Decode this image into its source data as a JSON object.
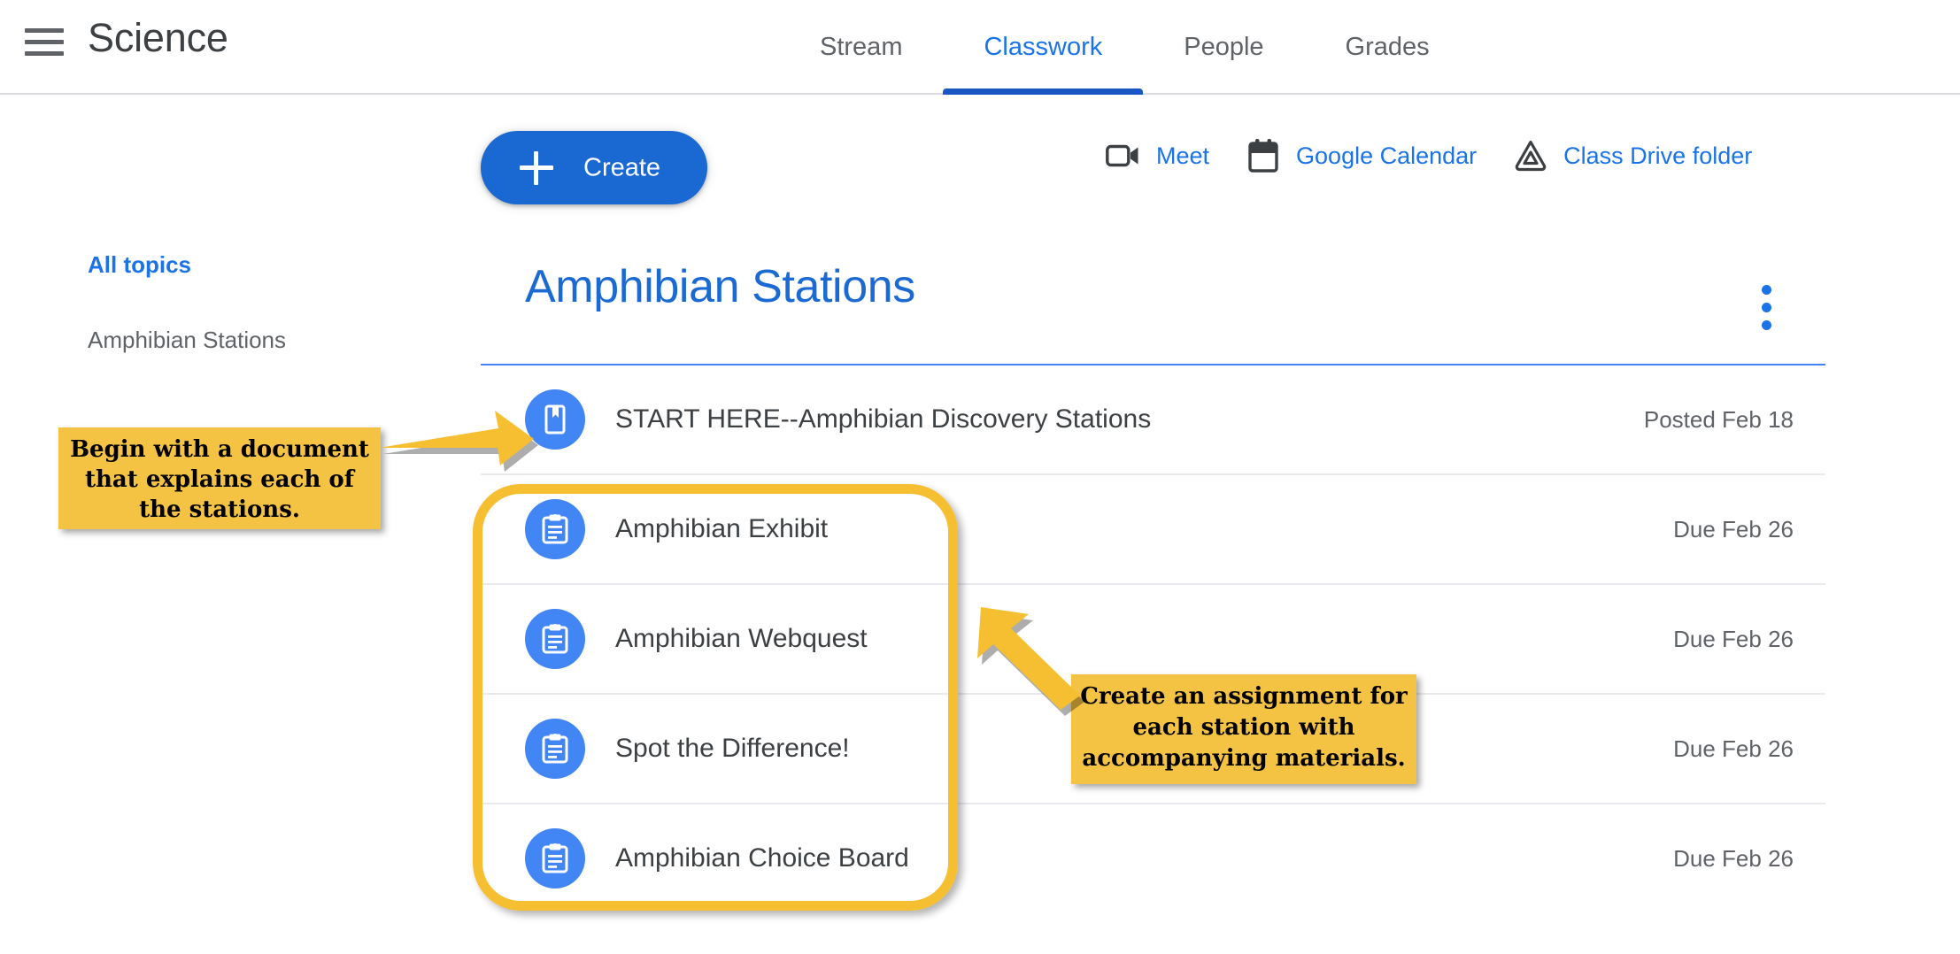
{
  "app": {
    "menu_icon": "hamburger-menu-icon",
    "class_title": "Science"
  },
  "tabs": [
    {
      "label": "Stream",
      "active": false
    },
    {
      "label": "Classwork",
      "active": true
    },
    {
      "label": "People",
      "active": false
    },
    {
      "label": "Grades",
      "active": false
    }
  ],
  "toolbar": {
    "create_label": "Create",
    "create_icon": "plus-icon",
    "quick_links": [
      {
        "label": "Meet",
        "icon": "video-camera-icon"
      },
      {
        "label": "Google Calendar",
        "icon": "calendar-icon"
      },
      {
        "label": "Class Drive folder",
        "icon": "google-drive-icon"
      }
    ]
  },
  "sidebar": {
    "items": [
      {
        "label": "All topics",
        "active": true
      },
      {
        "label": "Amphibian Stations",
        "active": false
      }
    ]
  },
  "topic": {
    "title": "Amphibian Stations",
    "menu_icon": "more-vert-icon",
    "rows": [
      {
        "title": "START HERE--Amphibian Discovery Stations",
        "date": "Posted Feb 18",
        "icon": "material-book-icon"
      },
      {
        "title": "Amphibian Exhibit",
        "date": "Due Feb 26",
        "icon": "assignment-clipboard-icon"
      },
      {
        "title": "Amphibian Webquest",
        "date": "Due Feb 26",
        "icon": "assignment-clipboard-icon"
      },
      {
        "title": "Spot the Difference!",
        "date": "Due Feb 26",
        "icon": "assignment-clipboard-icon"
      },
      {
        "title": "Amphibian Choice Board",
        "date": "Due Feb 26",
        "icon": "assignment-clipboard-icon"
      }
    ]
  },
  "annotations": {
    "callout_1": "Begin with a document that explains each of the stations.",
    "callout_2": "Create an assignment for each station with accompanying materials."
  },
  "colors": {
    "accent_blue": "#1a73e8",
    "tab_underline": "#1a56c4",
    "create_button": "#1a68d1",
    "icon_circle": "#4285f4",
    "title_blue": "#1b6ad4",
    "annotation_yellow": "#f5c344",
    "highlight_border": "#f5bf31",
    "text_primary": "#3c4043",
    "text_secondary": "#5f6368"
  }
}
